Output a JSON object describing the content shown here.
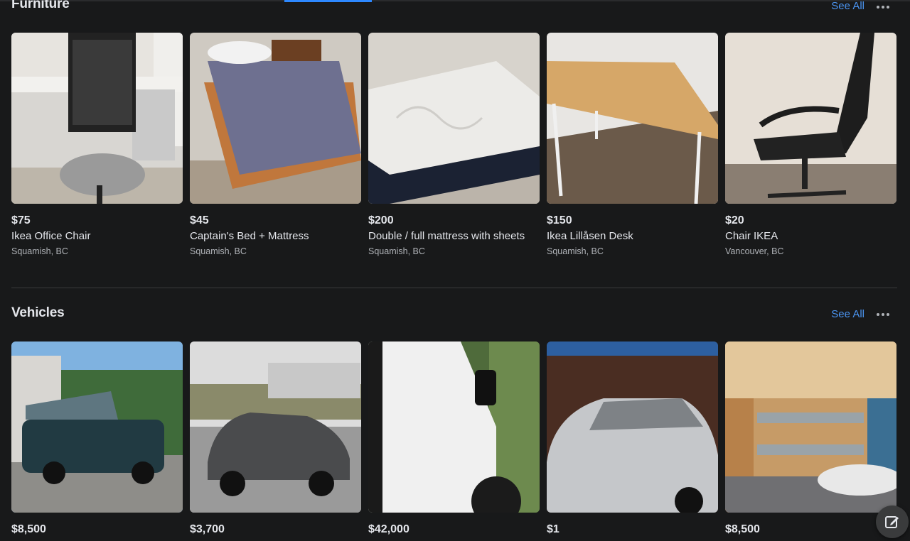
{
  "furniture": {
    "title": "Furniture",
    "see_all": "See All",
    "items": [
      {
        "price": "$75",
        "name": "Ikea Office Chair",
        "location": "Squamish, BC"
      },
      {
        "price": "$45",
        "name": "Captain's Bed + Mattress",
        "location": "Squamish, BC"
      },
      {
        "price": "$200",
        "name": "Double / full mattress with sheets",
        "location": "Squamish, BC"
      },
      {
        "price": "$150",
        "name": "Ikea Lillåsen Desk",
        "location": "Squamish, BC"
      },
      {
        "price": "$20",
        "name": "Chair IKEA",
        "location": "Vancouver, BC"
      }
    ]
  },
  "vehicles": {
    "title": "Vehicles",
    "see_all": "See All",
    "items": [
      {
        "price": "$8,500"
      },
      {
        "price": "$3,700"
      },
      {
        "price": "$42,000"
      },
      {
        "price": "$1"
      },
      {
        "price": "$8,500"
      }
    ]
  },
  "icons": {
    "more": "more-icon",
    "compose": "compose-icon"
  },
  "colors": {
    "background": "#18191a",
    "accent": "#2d88ff",
    "link": "#4b95f2"
  }
}
